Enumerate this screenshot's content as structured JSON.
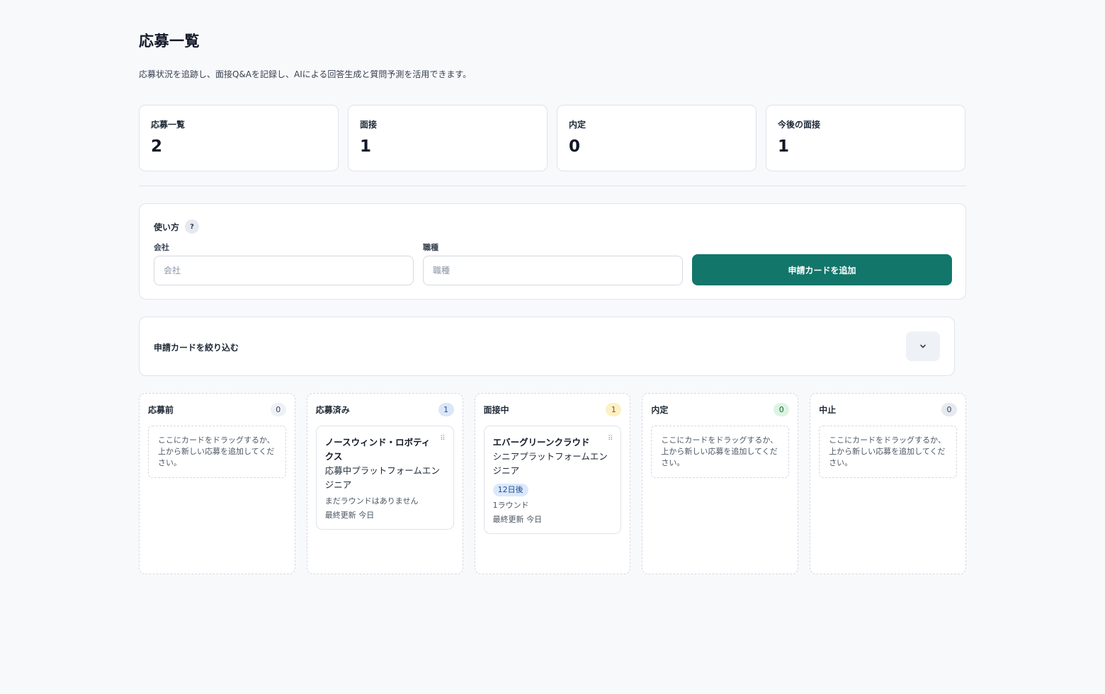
{
  "header": {
    "title": "応募一覧",
    "description": "応募状況を追跡し、面接Q&Aを記録し、AIによる回答生成と質問予測を活用できます。"
  },
  "stats": [
    {
      "label": "応募一覧",
      "value": "2"
    },
    {
      "label": "面接",
      "value": "1"
    },
    {
      "label": "内定",
      "value": "0"
    },
    {
      "label": "今後の面接",
      "value": "1"
    }
  ],
  "add_form": {
    "howto_label": "使い方",
    "help_icon": "?",
    "company_label": "会社",
    "company_placeholder": "会社",
    "company_value": "",
    "role_label": "職種",
    "role_placeholder": "職種",
    "role_value": "",
    "submit_label": "申請カードを追加"
  },
  "filter": {
    "label": "申請カードを絞り込む",
    "toggle_icon": "chevron-down-icon"
  },
  "columns": [
    {
      "title": "応募前",
      "count": "0",
      "count_bg": "#eef1f5",
      "count_color": "#374151",
      "empty_text": "ここにカードをドラッグするか、上から新しい応募を追加してください。"
    },
    {
      "title": "応募済み",
      "count": "1",
      "count_bg": "#dbe7f8",
      "count_color": "#1e4e9a",
      "card": {
        "company": "ノースウィンド・ロボティクス",
        "role": "応募中プラットフォームエンジニア",
        "rounds": "まだラウンドはありません",
        "updated": "最終更新 今日"
      }
    },
    {
      "title": "面接中",
      "count": "1",
      "count_bg": "#fdf0c4",
      "count_color": "#8a5a00",
      "card": {
        "company": "エバーグリーンクラウド",
        "role": "シニアプラットフォームエンジニア",
        "badge": "12日後",
        "rounds": "1ラウンド",
        "updated": "最終更新 今日"
      }
    },
    {
      "title": "内定",
      "count": "0",
      "count_bg": "#dcf5e3",
      "count_color": "#166534",
      "empty_text": "ここにカードをドラッグするか、上から新しい応募を追加してください。"
    },
    {
      "title": "中止",
      "count": "0",
      "count_bg": "#e5e9f0",
      "count_color": "#374151",
      "empty_text": "ここにカードをドラッグするか、上から新しい応募を追加してください。"
    }
  ]
}
